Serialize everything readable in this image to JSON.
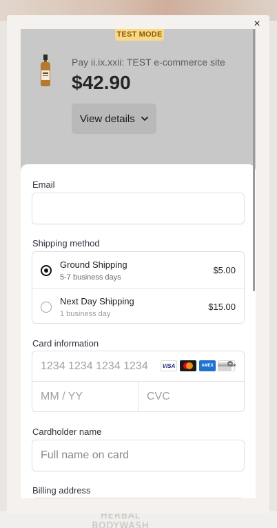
{
  "modal": {
    "close_glyph": "×"
  },
  "badge": {
    "label": "TEST MODE"
  },
  "header": {
    "merchant": "Pay ii.ix.xxii: TEST e-commerce site",
    "price": "$42.90",
    "details_button": "View details"
  },
  "form": {
    "email_label": "Email",
    "email_value": "",
    "shipping_label": "Shipping method",
    "shipping_options": [
      {
        "name": "Ground Shipping",
        "sub": "5-7 business days",
        "price": "$5.00",
        "selected": true
      },
      {
        "name": "Next Day Shipping",
        "sub": "1 business day",
        "price": "$15.00",
        "selected": false
      }
    ],
    "card_label": "Card information",
    "card_number_placeholder": "1234 1234 1234 1234",
    "expiry_placeholder": "MM / YY",
    "cvc_placeholder": "CVC",
    "card_brands": [
      "VISA",
      "mastercard",
      "AMEX",
      "DISCOVER"
    ],
    "cardholder_label": "Cardholder name",
    "cardholder_placeholder": "Full name on card",
    "billing_label": "Billing address"
  },
  "background": {
    "bottom_text": "HERBAL BODYWASH"
  },
  "colors": {
    "test_badge": "#f9d889",
    "header_bg": "#c8c8c8",
    "sheet_bg": "#ffffff"
  },
  "icons": {
    "close": "close-icon",
    "chevron": "chevron-down-icon",
    "cvc": "cvc-card-icon"
  }
}
